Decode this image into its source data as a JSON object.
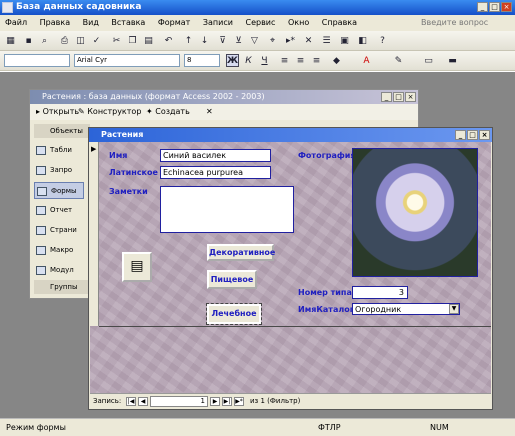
{
  "app": {
    "title": "База данных садовника"
  },
  "menu": {
    "items": [
      "Файл",
      "Правка",
      "Вид",
      "Вставка",
      "Формат",
      "Записи",
      "Сервис",
      "Окно",
      "Справка"
    ],
    "help_placeholder": "Введите вопрос"
  },
  "format_bar": {
    "font_name": "Arial Cyr",
    "font_size": "8"
  },
  "db_window": {
    "title": "Растения : база данных (формат Access 2002 - 2003)",
    "toolbar": {
      "open": "Открыть",
      "design": "Конструктор",
      "create": "Создать"
    },
    "objects_header": "Объекты",
    "objects": [
      "Табли",
      "Запро",
      "Формы",
      "Отчет",
      "Страни",
      "Макро",
      "Модул"
    ],
    "groups_header": "Группы"
  },
  "form": {
    "title": "Растения",
    "labels": {
      "name": "Имя",
      "latin": "Латинское И",
      "notes": "Заметки",
      "photo": "Фотография",
      "number": "Номер типа",
      "catalog": "ИмяКаталога"
    },
    "values": {
      "name": "Синий василек",
      "latin": "Echinacea purpurea",
      "notes": "",
      "number": "3",
      "catalog": "Огородник"
    },
    "buttons": {
      "decorative": "Декоративное",
      "food": "Пищевое",
      "medicinal": "Лечебное"
    },
    "nav": {
      "records_label": "Запись:",
      "current": "1",
      "total_text": "из 1 (Фильтр)"
    }
  },
  "status": {
    "mode": "Режим формы",
    "ftr": "ФТЛР",
    "num": "NUM"
  }
}
